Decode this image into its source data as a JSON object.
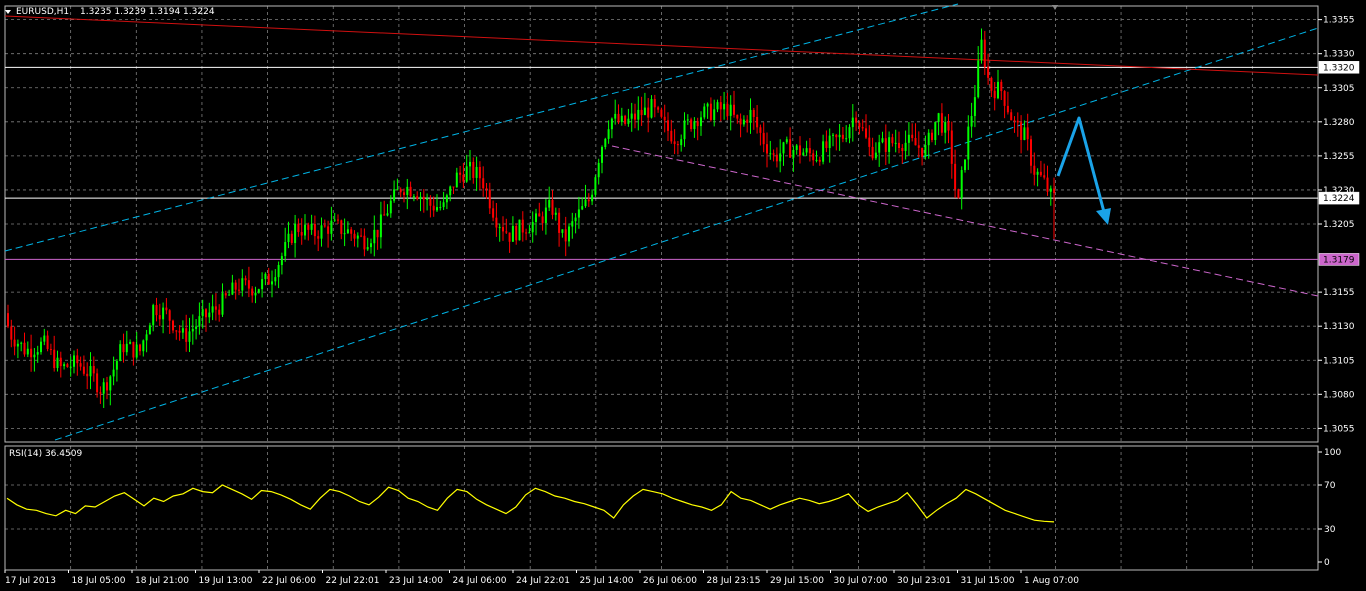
{
  "header": {
    "menu_icon": "triangle-down-icon",
    "symbol": "EURUSD,H1",
    "ohlc": "1.3235 1.3239 1.3194 1.3224"
  },
  "rsi": {
    "label": "RSI(14) 36.4509"
  },
  "colors": {
    "background": "#000000",
    "grid": "#7f7f7f",
    "bull": "#00ff00",
    "bear": "#ff0000",
    "rsi_line": "#ffff00",
    "channel": "#00b4e6",
    "support_line": "#cc66cc",
    "resistance_line": "#d01010",
    "arrow": "#1aa3e8"
  },
  "chart_data": [
    {
      "type": "candlestick",
      "title": "EURUSD,H1",
      "price_scale": [
        "1.3355",
        "1.3330",
        "1.3305",
        "1.3280",
        "1.3255",
        "1.3230",
        "1.3205",
        "1.3155",
        "1.3130",
        "1.3105",
        "1.3080",
        "1.3055"
      ],
      "ylim": [
        1.3045,
        1.3365
      ],
      "time_labels": [
        "17 Jul 2013",
        "18 Jul 05:00",
        "18 Jul 21:00",
        "19 Jul 13:00",
        "22 Jul 06:00",
        "22 Jul 22:01",
        "23 Jul 14:00",
        "24 Jul 06:00",
        "24 Jul 22:01",
        "25 Jul 14:00",
        "26 Jul 06:00",
        "28 Jul 23:15",
        "29 Jul 15:00",
        "30 Jul 07:00",
        "30 Jul 23:01",
        "31 Jul 15:00",
        "1 Aug 07:00"
      ],
      "grid": true,
      "horizontal_lines": [
        {
          "price": 1.332,
          "label": "1.3320",
          "color": "#ffffff"
        },
        {
          "price": 1.3224,
          "label": "1.3224",
          "color": "#ffffff"
        },
        {
          "price": 1.3179,
          "label": "1.3179",
          "color": "#cc66cc"
        }
      ],
      "path": [
        [
          0,
          1.316
        ],
        [
          12,
          1.3125
        ],
        [
          28,
          1.3112
        ],
        [
          46,
          1.3117
        ],
        [
          62,
          1.3099
        ],
        [
          80,
          1.3103
        ],
        [
          96,
          1.3092
        ],
        [
          104,
          1.3083
        ],
        [
          115,
          1.3097
        ],
        [
          125,
          1.3116
        ],
        [
          142,
          1.3111
        ],
        [
          156,
          1.3145
        ],
        [
          170,
          1.3138
        ],
        [
          186,
          1.3122
        ],
        [
          204,
          1.3135
        ],
        [
          222,
          1.3145
        ],
        [
          240,
          1.316
        ],
        [
          258,
          1.3158
        ],
        [
          272,
          1.3165
        ],
        [
          286,
          1.3184
        ],
        [
          298,
          1.3203
        ],
        [
          316,
          1.3198
        ],
        [
          334,
          1.3204
        ],
        [
          352,
          1.3199
        ],
        [
          366,
          1.3193
        ],
        [
          380,
          1.32
        ],
        [
          392,
          1.3219
        ],
        [
          404,
          1.3233
        ],
        [
          418,
          1.323
        ],
        [
          432,
          1.3219
        ],
        [
          446,
          1.3217
        ],
        [
          458,
          1.3239
        ],
        [
          470,
          1.3245
        ],
        [
          484,
          1.3239
        ],
        [
          498,
          1.321
        ],
        [
          512,
          1.3197
        ],
        [
          526,
          1.3203
        ],
        [
          540,
          1.3207
        ],
        [
          554,
          1.3218
        ],
        [
          566,
          1.3192
        ],
        [
          578,
          1.3209
        ],
        [
          592,
          1.3223
        ],
        [
          602,
          1.3258
        ],
        [
          612,
          1.3283
        ],
        [
          626,
          1.3278
        ],
        [
          640,
          1.3285
        ],
        [
          654,
          1.329
        ],
        [
          666,
          1.3277
        ],
        [
          678,
          1.3268
        ],
        [
          690,
          1.3278
        ],
        [
          702,
          1.3285
        ],
        [
          716,
          1.3288
        ],
        [
          730,
          1.329
        ],
        [
          742,
          1.3276
        ],
        [
          752,
          1.3287
        ],
        [
          764,
          1.3269
        ],
        [
          776,
          1.3254
        ],
        [
          790,
          1.3261
        ],
        [
          804,
          1.3258
        ],
        [
          818,
          1.3255
        ],
        [
          832,
          1.3263
        ],
        [
          846,
          1.327
        ],
        [
          858,
          1.3287
        ],
        [
          872,
          1.3259
        ],
        [
          886,
          1.3263
        ],
        [
          900,
          1.3266
        ],
        [
          914,
          1.3264
        ],
        [
          928,
          1.3259
        ],
        [
          940,
          1.3285
        ],
        [
          952,
          1.3266
        ],
        [
          960,
          1.3215
        ],
        [
          968,
          1.3262
        ],
        [
          976,
          1.3295
        ],
        [
          984,
          1.3338
        ],
        [
          992,
          1.3305
        ],
        [
          1004,
          1.3303
        ],
        [
          1016,
          1.3279
        ],
        [
          1028,
          1.3268
        ],
        [
          1036,
          1.3245
        ],
        [
          1046,
          1.3236
        ],
        [
          1054,
          1.3224
        ]
      ],
      "trendlines": [
        {
          "name": "upper-channel",
          "from": [
            "17 Jul 2013",
            1.3205
          ],
          "to": [
            "31 Jul 03:00",
            1.3362
          ],
          "style": "dashed",
          "color": "#00b4e6"
        },
        {
          "name": "lower-channel",
          "from": [
            "18 Jul 05:00",
            1.305
          ],
          "to": [
            "1 Aug 23:00",
            1.3345
          ],
          "style": "dashed",
          "color": "#00b4e6"
        },
        {
          "name": "resistance",
          "from": [
            "17 Jul 2013",
            1.3355
          ],
          "to": [
            "1 Aug 23:00",
            1.3313
          ],
          "style": "solid",
          "color": "#d01010"
        },
        {
          "name": "support",
          "from": [
            "25 Jul 14:00",
            1.3262
          ],
          "to": [
            "1 Aug 23:00",
            1.3157
          ],
          "style": "dashed",
          "color": "#cc66cc"
        }
      ]
    },
    {
      "type": "line",
      "title": "RSI(14) 36.4509",
      "ylim": [
        0,
        100
      ],
      "levels": [
        "100",
        "70",
        "30",
        "0"
      ],
      "values": [
        58,
        52,
        48,
        47,
        44,
        42,
        47,
        44,
        51,
        50,
        55,
        60,
        63,
        57,
        51,
        58,
        55,
        60,
        62,
        67,
        64,
        63,
        70,
        66,
        62,
        57,
        65,
        64,
        61,
        57,
        52,
        48,
        58,
        66,
        64,
        60,
        55,
        52,
        59,
        68,
        65,
        58,
        55,
        50,
        47,
        58,
        66,
        64,
        57,
        52,
        48,
        44,
        50,
        61,
        67,
        64,
        60,
        58,
        55,
        53,
        50,
        47,
        40,
        52,
        60,
        66,
        64,
        62,
        58,
        55,
        52,
        50,
        47,
        52,
        64,
        58,
        56,
        52,
        48,
        52,
        55,
        58,
        56,
        53,
        55,
        58,
        62,
        52,
        46,
        50,
        53,
        56,
        63,
        52,
        40,
        47,
        53,
        58,
        66,
        62,
        57,
        52,
        47,
        44,
        41,
        38,
        37,
        36.45
      ]
    }
  ]
}
